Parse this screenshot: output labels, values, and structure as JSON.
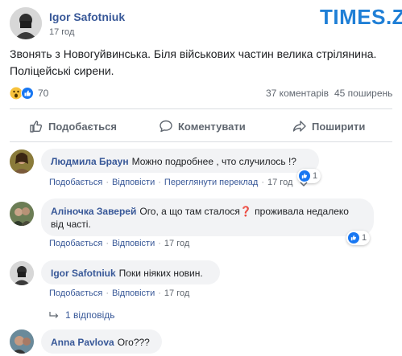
{
  "post": {
    "author": "Igor Safotniuk",
    "time": "17 год",
    "text_line1": "Звонять з Новогуйвинська. Біля військових частин велика стрілянина.",
    "text_line2": "Поліцейські сирени.",
    "reactions_count": "70",
    "comments_count": "37 коментарів",
    "shares_count": "45 поширень"
  },
  "watermark": "TIMES.ZT",
  "actions": {
    "like": "Подобається",
    "comment": "Коментувати",
    "share": "Поширити"
  },
  "comments": [
    {
      "author": "Людмила Браун",
      "text": "Можно подробнее , что случилось !?",
      "like": "Подобається",
      "reply": "Відповісти",
      "translate": "Переглянути переклад",
      "time": "17 год",
      "reactions": "1"
    },
    {
      "author": "Аліночка Заверей",
      "text_line1": "Ого, а що там сталося❓ проживала недалеко",
      "text_line2": "від частi.",
      "like": "Подобається",
      "reply": "Відповісти",
      "time": "17 год",
      "reactions": "1"
    },
    {
      "author": "Igor Safotniuk",
      "text": "Поки ніяких новин.",
      "like": "Подобається",
      "reply": "Відповісти",
      "time": "17 год",
      "replies": "1 відповідь"
    },
    {
      "author": "Anna Pavlova",
      "text": "Ого???"
    }
  ],
  "colors": {
    "link": "#385898",
    "like_blue": "#1877f2",
    "bubble": "#f2f3f5",
    "watermark": "#1f7fd6"
  }
}
